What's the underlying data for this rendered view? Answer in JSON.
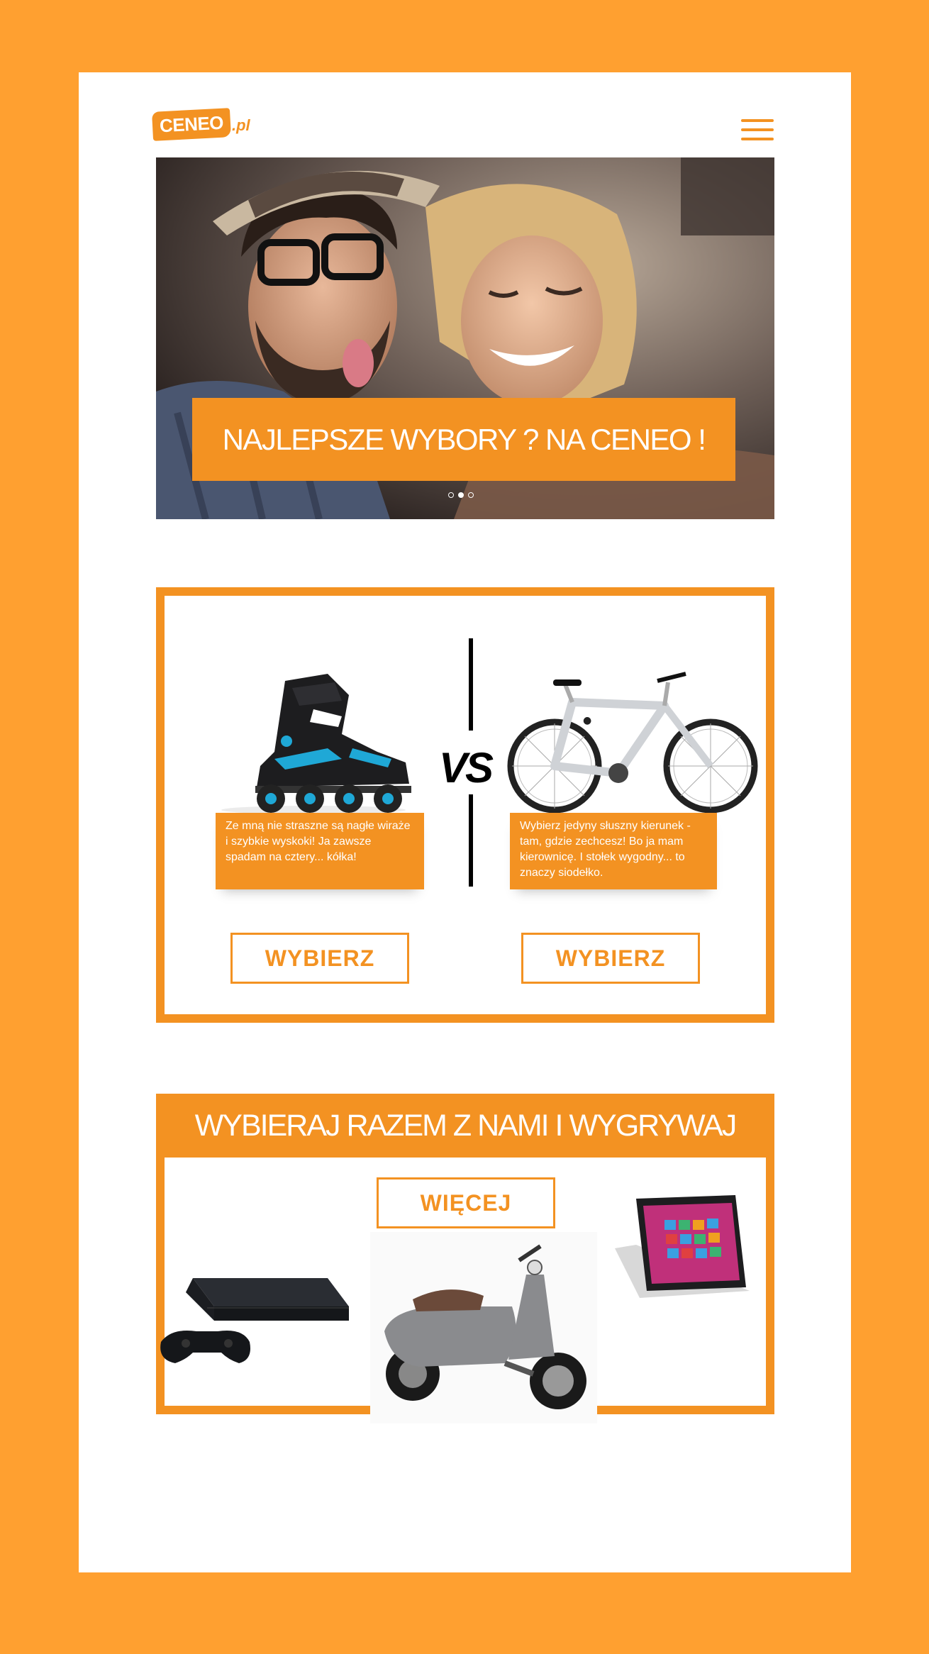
{
  "brand": {
    "logo_text": "CENEO",
    "logo_suffix": ".pl",
    "accent_color": "#F39222",
    "background_color": "#FFA030"
  },
  "header": {
    "menu_icon": "hamburger-menu-icon"
  },
  "hero": {
    "headline": "NAJLEPSZE WYBORY ?  NA CENEO !",
    "slides": 3,
    "active_slide": 2
  },
  "compare": {
    "vs_label": "VS",
    "left": {
      "product": "inline skates",
      "caption": "Ze mną nie straszne są nagłe wiraże i  szybkie wyskoki! Ja zawsze spadam na cztery... kółka!",
      "button_label": "WYBIERZ"
    },
    "right": {
      "product": "bicycle",
      "caption": "Wybierz jedyny słuszny kierunek - tam, gdzie zechcesz! Bo ja mam kierownicę. I stołek wygodny... to znaczy siodełko.",
      "button_label": "WYBIERZ"
    }
  },
  "contest": {
    "title": "WYBIERAJ RAZEM Z NAMI I WYGRYWAJ",
    "more_label": "WIĘCEJ",
    "prizes": [
      "game console",
      "scooter",
      "tablet"
    ]
  }
}
